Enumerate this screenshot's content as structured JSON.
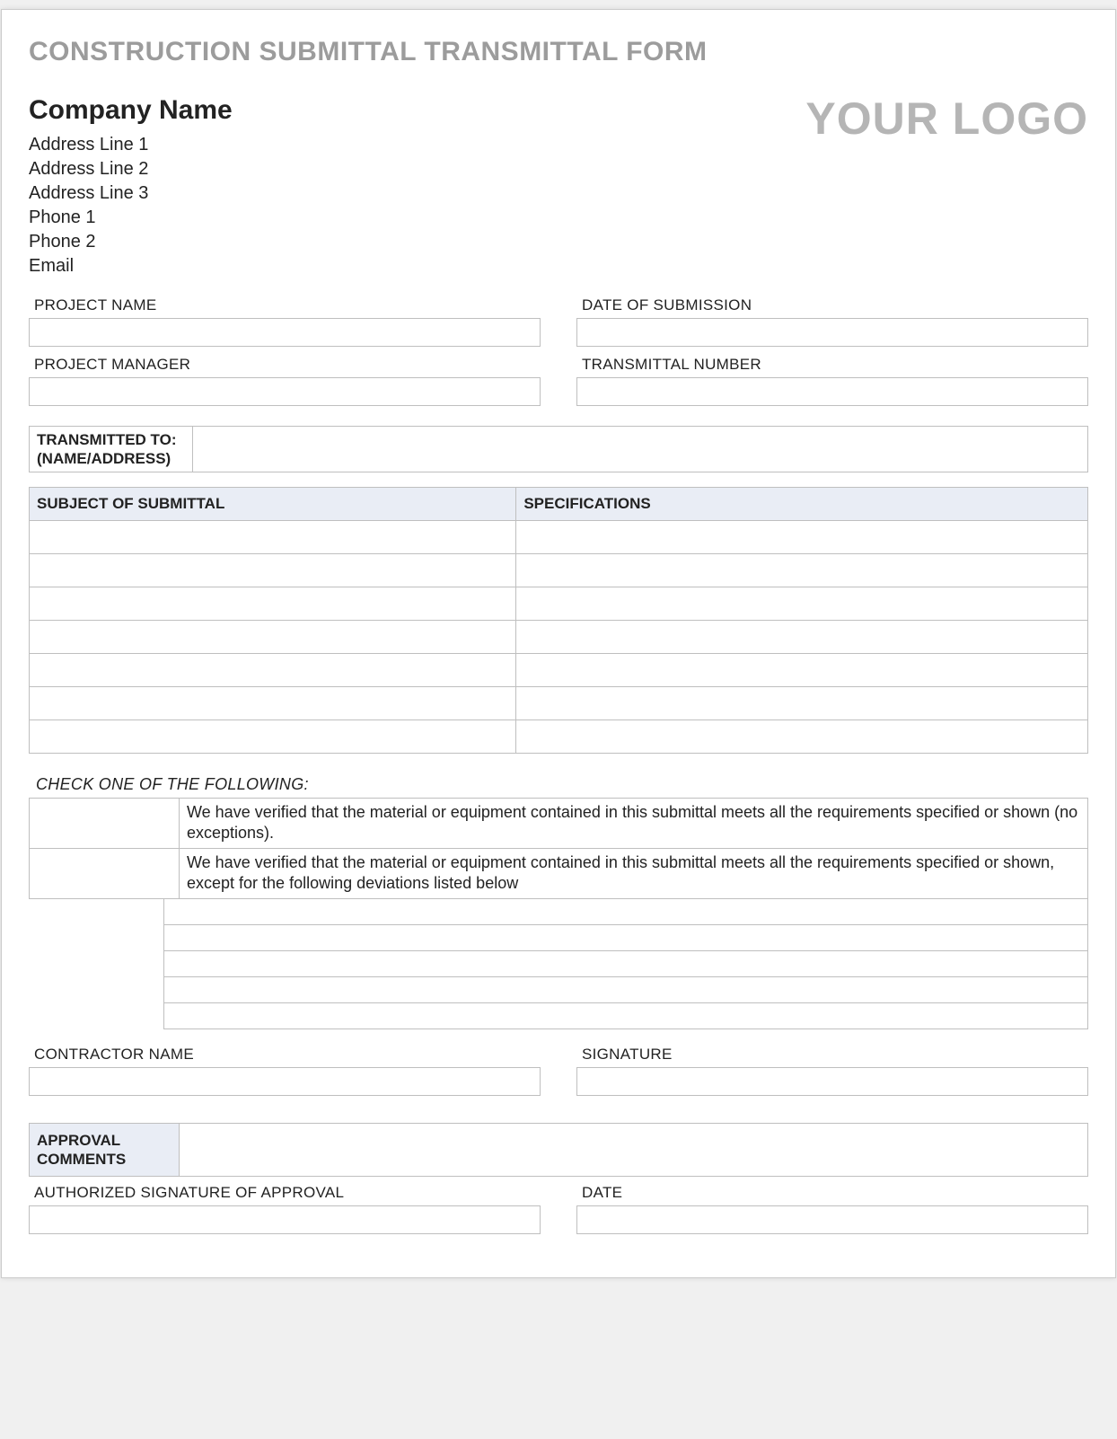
{
  "title": "CONSTRUCTION SUBMITTAL TRANSMITTAL FORM",
  "company": {
    "name": "Company Name",
    "address1": "Address Line 1",
    "address2": "Address Line 2",
    "address3": "Address Line 3",
    "phone1": "Phone 1",
    "phone2": "Phone 2",
    "email": "Email"
  },
  "logo": "YOUR LOGO",
  "fields": {
    "project_name": "PROJECT NAME",
    "date_submission": "DATE OF SUBMISSION",
    "project_manager": "PROJECT MANAGER",
    "transmittal_number": "TRANSMITTAL NUMBER",
    "contractor_name": "CONTRACTOR NAME",
    "signature": "SIGNATURE",
    "auth_sig": "AUTHORIZED SIGNATURE OF APPROVAL",
    "date": "DATE"
  },
  "transmitted_to": "TRANSMITTED TO: (NAME/ADDRESS)",
  "table_headers": {
    "subject": "SUBJECT OF SUBMITTAL",
    "specs": "SPECIFICATIONS"
  },
  "check_title": "CHECK ONE OF THE FOLLOWING:",
  "check_options": {
    "opt1": "We have verified that the material or equipment contained in this submittal meets all the requirements specified or shown (no exceptions).",
    "opt2": "We have verified that the material or equipment contained in this submittal meets all the requirements specified or shown, except for the following deviations listed below"
  },
  "approval": "APPROVAL COMMENTS"
}
